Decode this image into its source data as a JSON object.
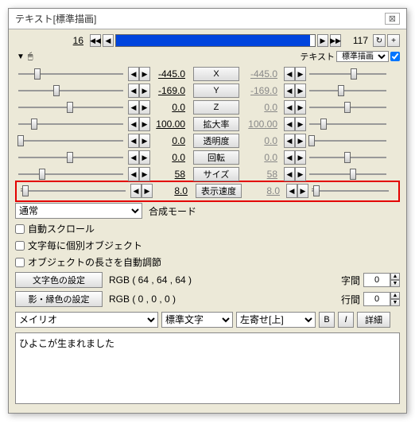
{
  "title": "テキスト[標準描画]",
  "timeline": {
    "start": "16",
    "end": "117"
  },
  "header": {
    "section_label": "テキスト",
    "mode_combo": "標準描画"
  },
  "params": [
    {
      "name": "X",
      "left_val": "-445.0",
      "right_val": "-445.0",
      "lpos": 24,
      "rpos": 56
    },
    {
      "name": "Y",
      "left_val": "-169.0",
      "right_val": "-169.0",
      "lpos": 48,
      "rpos": 40
    },
    {
      "name": "Z",
      "left_val": "0.0",
      "right_val": "0.0",
      "lpos": 65,
      "rpos": 48
    },
    {
      "name": "拡大率",
      "left_val": "100.00",
      "right_val": "100.00",
      "lpos": 20,
      "rpos": 18
    },
    {
      "name": "透明度",
      "left_val": "0.0",
      "right_val": "0.0",
      "lpos": 3,
      "rpos": 3
    },
    {
      "name": "回転",
      "left_val": "0.0",
      "right_val": "0.0",
      "lpos": 65,
      "rpos": 48
    },
    {
      "name": "サイズ",
      "left_val": "58",
      "right_val": "58",
      "lpos": 30,
      "rpos": 55
    },
    {
      "name": "表示速度",
      "left_val": "8.0",
      "right_val": "8.0",
      "lpos": 6,
      "rpos": 6,
      "dash": true
    }
  ],
  "compose": {
    "label": "合成モード",
    "value": "通常"
  },
  "checks": {
    "auto_scroll": "自動スクロール",
    "per_char": "文字毎に個別オブジェクト",
    "auto_len": "オブジェクトの長さを自動調節"
  },
  "settings": {
    "text_color_btn": "文字色の設定",
    "text_color_val": "RGB ( 64 , 64 , 64 )",
    "shadow_color_btn": "影・縁色の設定",
    "shadow_color_val": "RGB ( 0 , 0 , 0 )",
    "char_space_label": "字間",
    "char_space_val": "0",
    "line_space_label": "行間",
    "line_space_val": "0"
  },
  "font_row": {
    "font": "メイリオ",
    "style": "標準文字",
    "align": "左寄せ[上]",
    "bold": "B",
    "italic": "I",
    "detail": "詳細"
  },
  "textbox": "ひよこが生まれました"
}
